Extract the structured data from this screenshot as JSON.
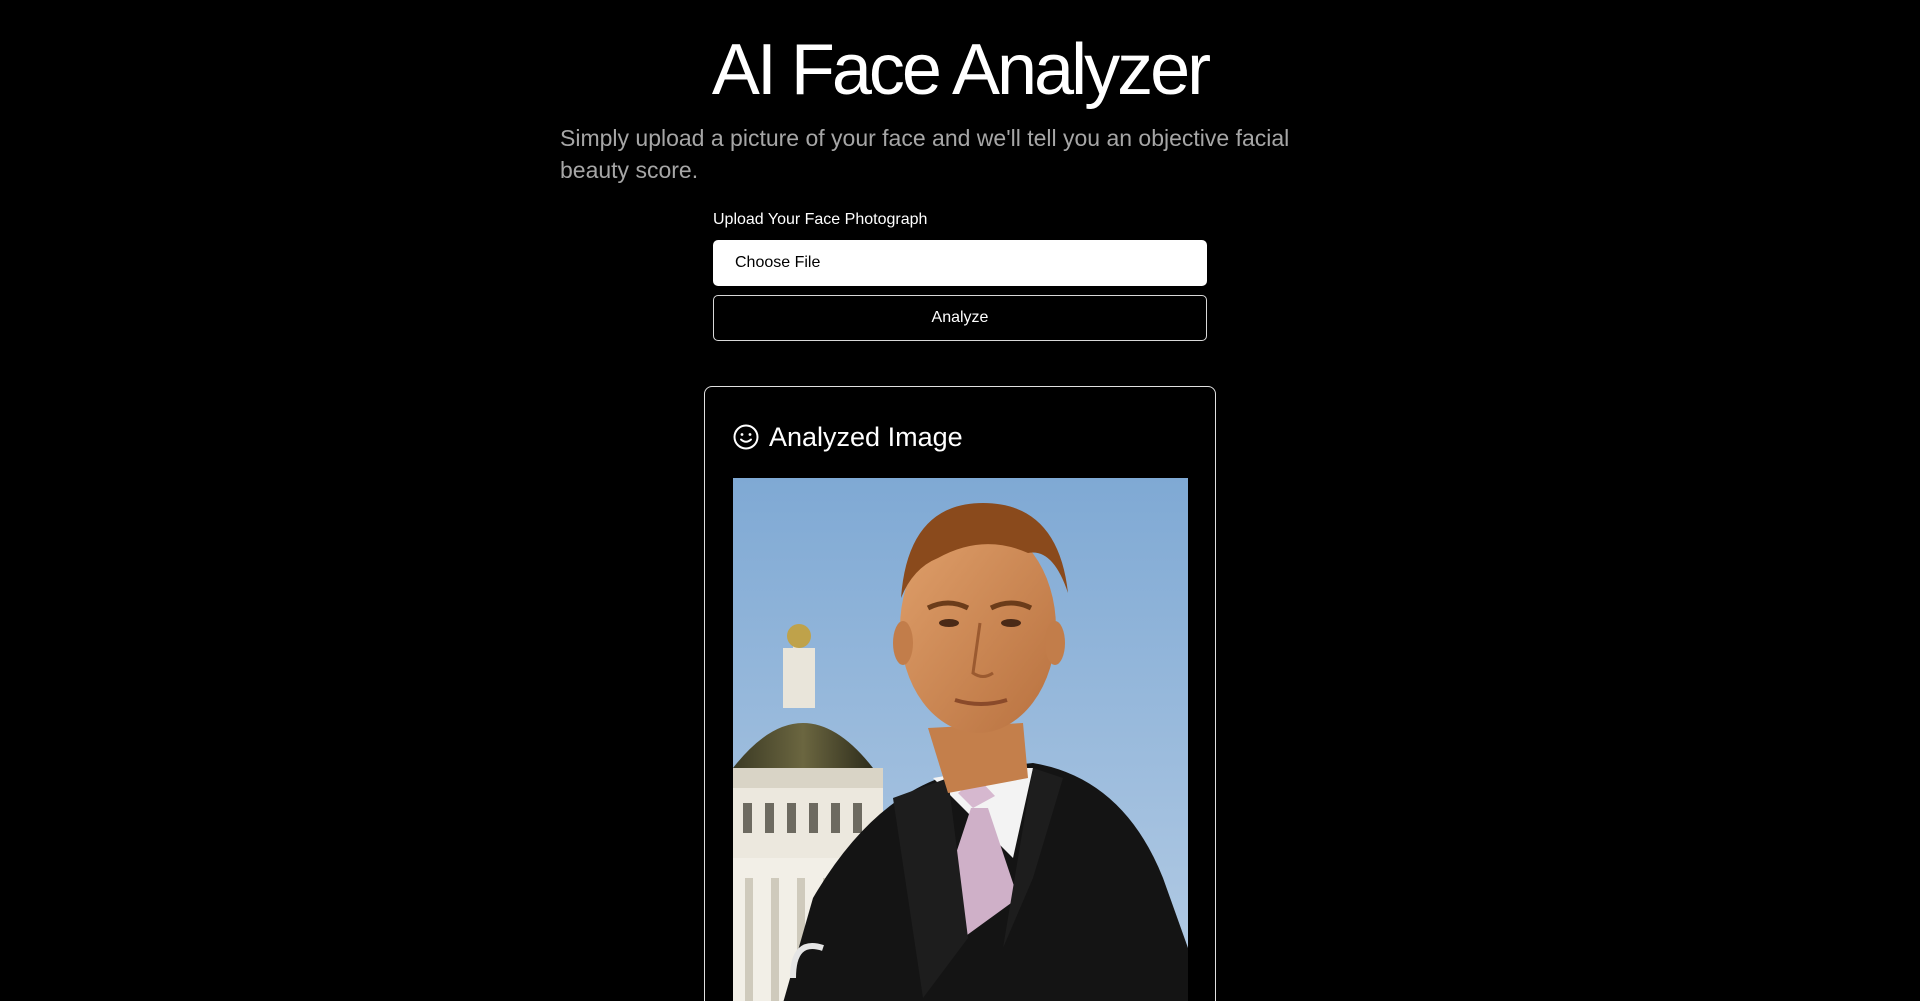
{
  "header": {
    "title": "AI Face Analyzer",
    "subtitle": "Simply upload a picture of your face and we'll tell you an objective facial beauty score."
  },
  "upload": {
    "label": "Upload Your Face Photograph",
    "file_button_label": "Choose File",
    "analyze_label": "Analyze"
  },
  "result_card": {
    "icon": "smiley-face-icon",
    "title": "Analyzed Image",
    "photo_subject": "portrait-photo"
  },
  "colors": {
    "background": "#000000",
    "text": "#ffffff",
    "subtitle": "#a6a6a6",
    "border": "#e0e0e0"
  }
}
